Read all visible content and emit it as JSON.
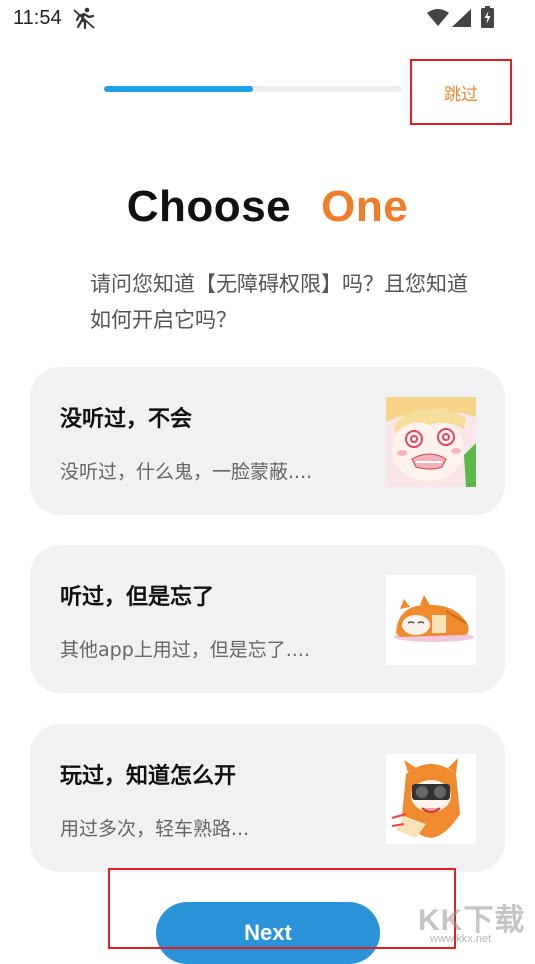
{
  "status_bar": {
    "time": "11:54",
    "icons": [
      "running-icon",
      "wifi-icon",
      "signal-icon",
      "battery-charging-icon"
    ]
  },
  "onboarding": {
    "progress": 0.5,
    "progress_color": "#1da1e6",
    "skip_label": "跳过",
    "title_word1": "Choose",
    "title_word2": "One",
    "title_accent_color": "#ef7d2a",
    "question": "请问您知道【无障碍权限】吗？且您知道如何开启它吗？"
  },
  "options": [
    {
      "title": "没听过，不会",
      "description": "没听过，什么鬼，一脸蒙蔽....",
      "image": "anime-girl-confused-icon"
    },
    {
      "title": "听过，但是忘了",
      "description": "其他app上用过，但是忘了....",
      "image": "anime-girl-sleeping-icon"
    },
    {
      "title": "玩过，知道怎么开",
      "description": "用过多次，轻车熟路...",
      "image": "anime-girl-camera-icon"
    }
  ],
  "next_button": {
    "label": "Next",
    "color": "#2b93d8"
  },
  "watermark": {
    "logo_text": "KK下载",
    "url": "www.kkx.net"
  }
}
